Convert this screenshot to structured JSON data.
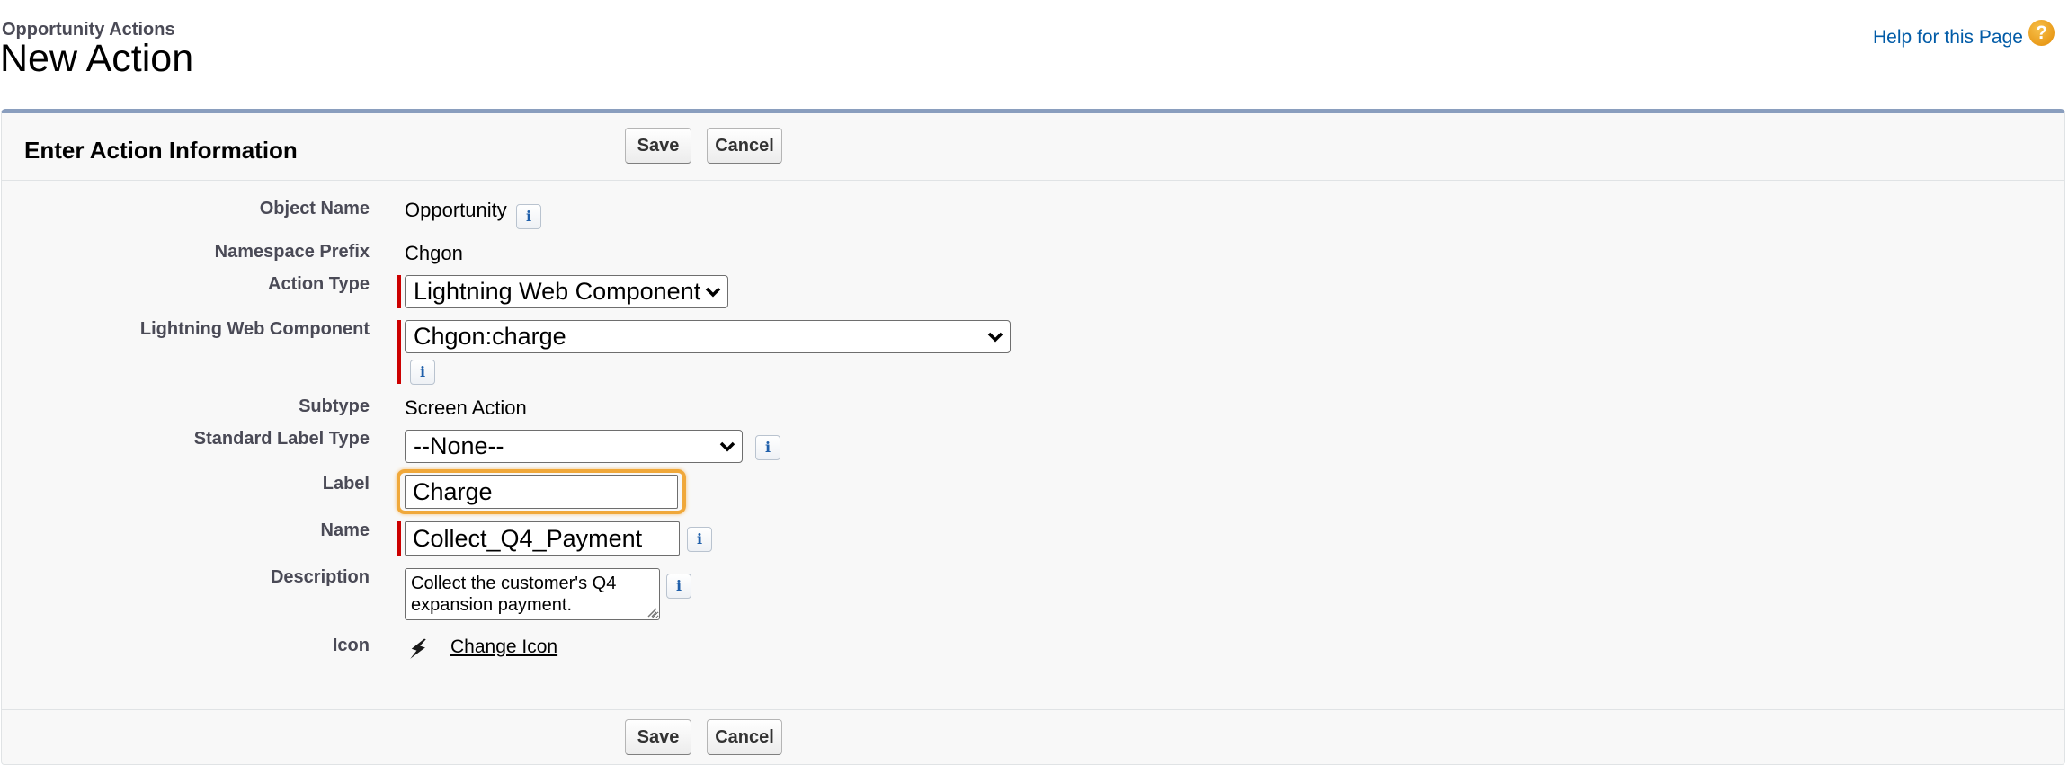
{
  "header": {
    "breadcrumb": "Opportunity Actions",
    "title": "New Action",
    "help_link": "Help for this Page",
    "help_icon": "question-mark-icon"
  },
  "panel": {
    "title": "Enter Action Information",
    "save_label": "Save",
    "cancel_label": "Cancel"
  },
  "fields": {
    "object_name": {
      "label": "Object Name",
      "value": "Opportunity"
    },
    "namespace_prefix": {
      "label": "Namespace Prefix",
      "value": "Chgon"
    },
    "action_type": {
      "label": "Action Type",
      "value": "Lightning Web Component"
    },
    "lwc": {
      "label": "Lightning Web Component",
      "value": "Chgon:charge"
    },
    "subtype": {
      "label": "Subtype",
      "value": "Screen Action"
    },
    "standard_label_type": {
      "label": "Standard Label Type",
      "value": "--None--"
    },
    "label": {
      "label": "Label",
      "value": "Charge"
    },
    "name": {
      "label": "Name",
      "value": "Collect_Q4_Payment"
    },
    "description": {
      "label": "Description",
      "value": "Collect the customer's Q4 expansion payment."
    },
    "icon": {
      "label": "Icon",
      "icon_name": "lightning-bolt-icon",
      "link": "Change Icon"
    }
  },
  "info_glyph": "i",
  "colors": {
    "required": "#cc0000",
    "focus": "#f0a83a",
    "panel_border_top": "#8a9ebe",
    "link": "#015ba7"
  }
}
